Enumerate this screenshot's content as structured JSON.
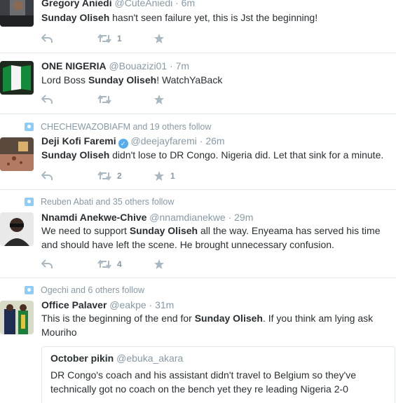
{
  "tweets": [
    {
      "name": "Gregory Aniedi",
      "handle": "@CuteAniedi",
      "time": "6m",
      "text_before": "",
      "highlight": "Sunday Oliseh",
      "text_after": " hasn't seen failure yet, this is Jst the beginning!",
      "retweets": "1",
      "likes": ""
    },
    {
      "name": "ONE NIGERIA",
      "handle": "@Bouazizi01",
      "time": "7m",
      "text_before": "Lord Boss ",
      "highlight": "Sunday Oliseh",
      "text_after": "! WatchYaBack",
      "retweets": "",
      "likes": ""
    },
    {
      "context": "CHECHEWAZOBIAFM and 19 others follow",
      "name": "Deji Kofi Faremi",
      "handle": "@deejayfaremi",
      "time": "26m",
      "text_before": "",
      "highlight": "Sunday Oliseh",
      "text_after": " didn't lose to DR Congo. Nigeria did. Let that sink for a minute.",
      "retweets": "2",
      "likes": "1"
    },
    {
      "context": "Reuben Abati and 35 others follow",
      "name": "Nnamdi Anekwe-Chive",
      "handle": "@nnamdianekwe",
      "time": "29m",
      "text_before": "We need to support ",
      "highlight": "Sunday Oliseh",
      "text_after": " all the way. Enyeama has served his time and should have left the scene. He brought unnecessary confusion.",
      "retweets": "4",
      "likes": ""
    },
    {
      "context": "Ogechi and 6 others follow",
      "name": "Office Palaver",
      "handle": "@eakpe",
      "time": "31m",
      "text_before": "This is the beginning of the end for ",
      "highlight": "Sunday Oliseh",
      "text_after": ". If you think am lying ask Mouriho",
      "quote": {
        "name": "October pikin",
        "handle": "@ebuka_akara",
        "text": "DR Congo's coach and his assistant didn't travel to Belgium so they've technically got no coach on the bench yet they re leading Nigeria 2-0"
      }
    }
  ],
  "separator": " · ",
  "colors": {
    "accent": "#55acee",
    "muted": "#8899a6",
    "icon": "#aab8c2",
    "text": "#292f33"
  }
}
